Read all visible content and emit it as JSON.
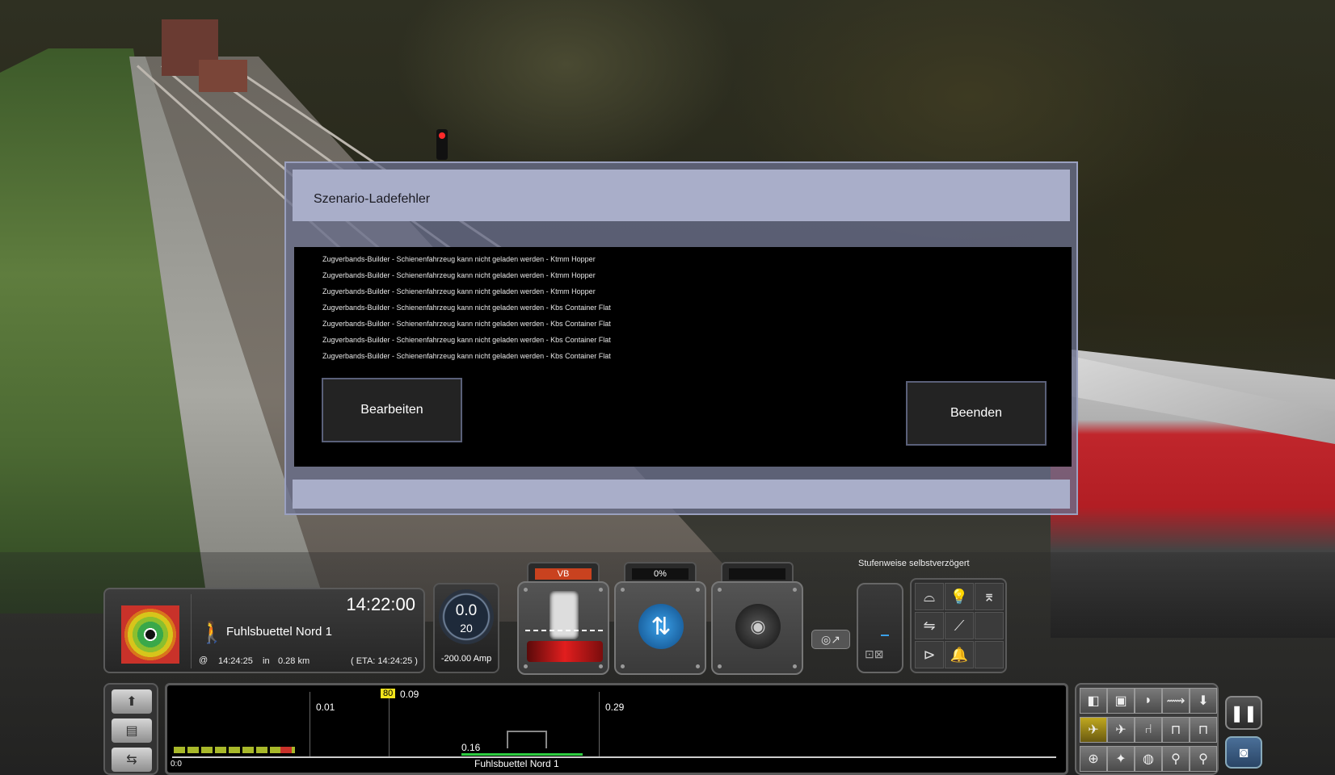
{
  "dialog": {
    "title": "Szenario-Ladefehler",
    "errors": [
      "Zugverbands-Builder - Schienenfahrzeug kann nicht geladen werden - Ktmm Hopper",
      "Zugverbands-Builder - Schienenfahrzeug kann nicht geladen werden - Ktmm Hopper",
      "Zugverbands-Builder - Schienenfahrzeug kann nicht geladen werden - Ktmm Hopper",
      "Zugverbands-Builder - Schienenfahrzeug kann nicht geladen werden - Kbs Container Flat",
      "Zugverbands-Builder - Schienenfahrzeug kann nicht geladen werden - Kbs Container Flat",
      "Zugverbands-Builder - Schienenfahrzeug kann nicht geladen werden - Kbs Container Flat",
      "Zugverbands-Builder - Schienenfahrzeug kann nicht geladen werden - Kbs Container Flat"
    ],
    "edit_label": "Bearbeiten",
    "quit_label": "Beenden"
  },
  "hud": {
    "clock": "14:22:00",
    "destination": "Fuhlsbuettel Nord 1",
    "at_symbol": "@",
    "arrival_time": "14:24:25",
    "in_word": "in",
    "distance": "0.28 km",
    "eta": "( ETA: 14:24:25 )",
    "speed": "0.0",
    "speed_limit": "20",
    "amperage": "-200.00 Amp",
    "throttle_tab": "VB",
    "reverser_tab": "0%",
    "brake_mode": "Stufenweise selbstverzögert"
  },
  "monitor": {
    "marker_1": "0.01",
    "speed_limit_badge": "80",
    "marker_2": "0.09",
    "marker_3": "0.29",
    "marker_4": "0.16",
    "start_label": "0:0",
    "station_label": "Fuhlsbuettel Nord 1"
  },
  "colors": {
    "accent_red": "#c9322a",
    "badge_yellow": "#f2e41c",
    "track_green": "#2ecc40"
  }
}
